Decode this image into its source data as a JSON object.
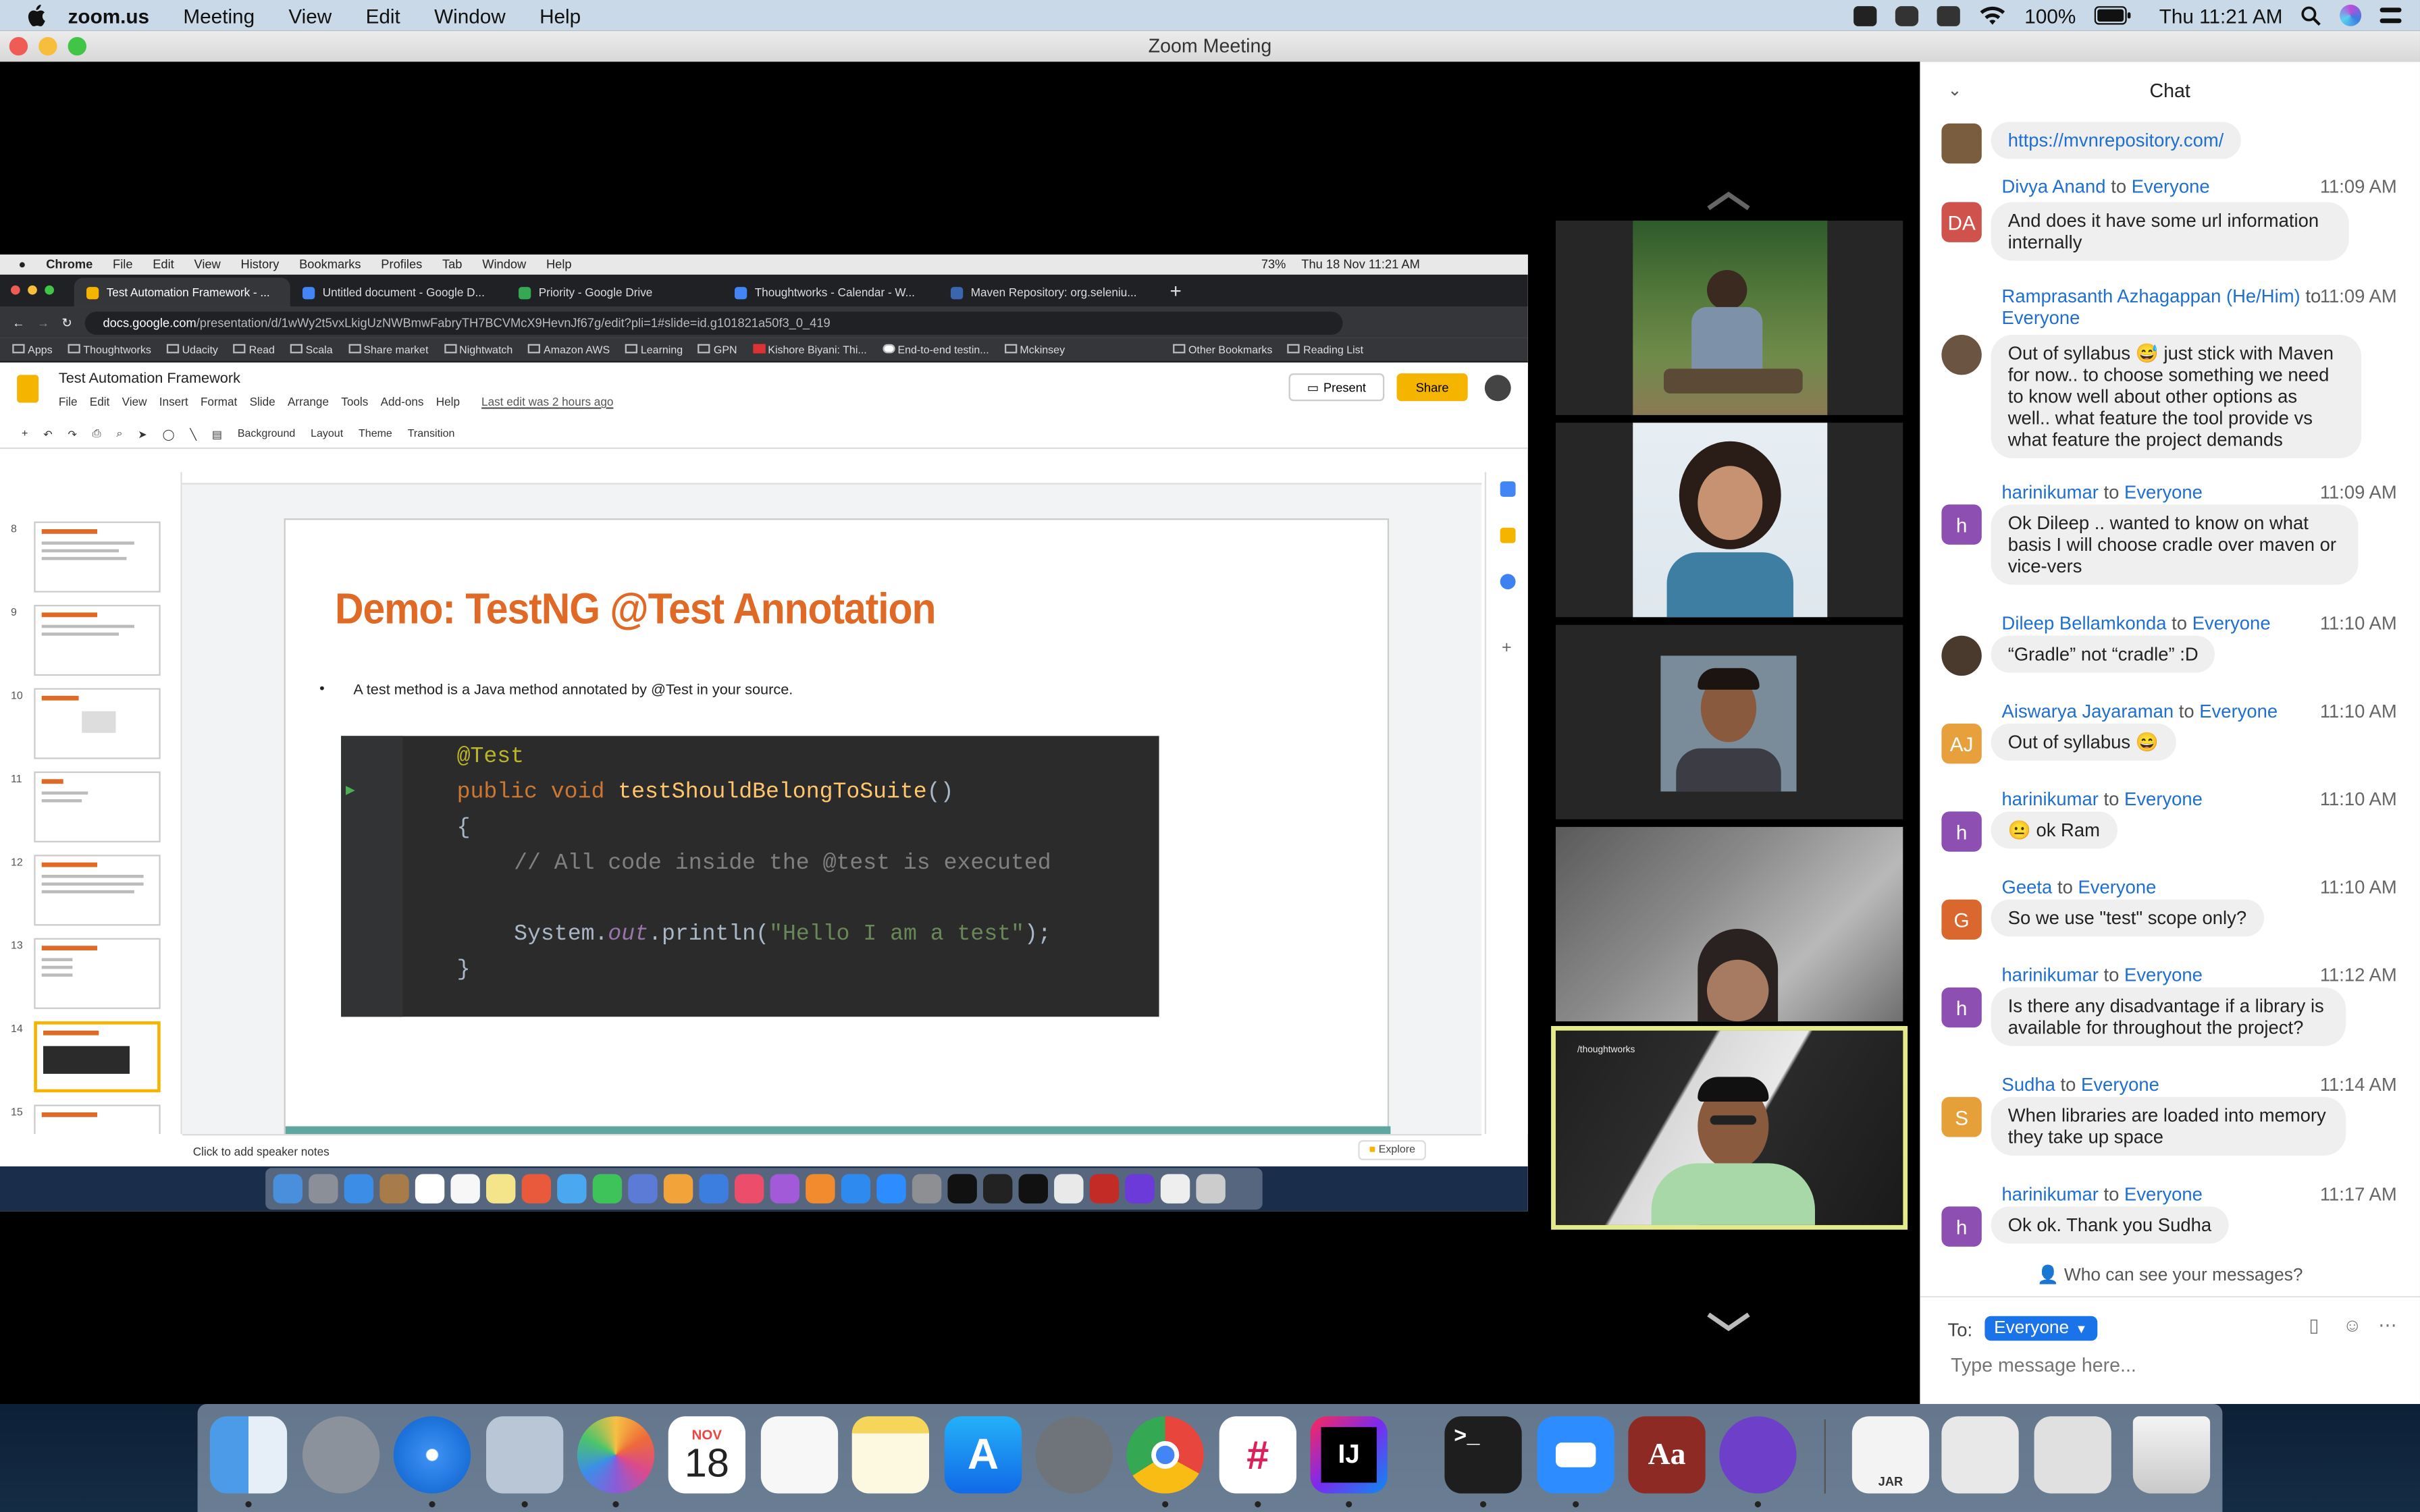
{
  "menubar": {
    "app": "zoom.us",
    "items": [
      "Meeting",
      "View",
      "Edit",
      "Window",
      "Help"
    ],
    "battery": "100%",
    "clock": "Thu 11:21 AM"
  },
  "window": {
    "title": "Zoom Meeting"
  },
  "shared": {
    "mac_menu": [
      "Chrome",
      "File",
      "Edit",
      "View",
      "History",
      "Bookmarks",
      "Profiles",
      "Tab",
      "Window",
      "Help"
    ],
    "mac_battery": "73%",
    "mac_clock": "Thu 18 Nov  11:21 AM",
    "tabs": [
      {
        "label": "Test Automation Framework - ...",
        "color": "#f4b400"
      },
      {
        "label": "Untitled document - Google D...",
        "color": "#4285f4"
      },
      {
        "label": "Priority - Google Drive",
        "color": "#34a853"
      },
      {
        "label": "Thoughtworks - Calendar - W...",
        "color": "#4285f4"
      },
      {
        "label": "Maven Repository: org.seleniu...",
        "color": "#3a66b0"
      }
    ],
    "url_host": "docs.google.com",
    "url_path": "/presentation/d/1wWy2t5vxLkigUzNWBmwFabryTH7BCVMcX9HevnJf67g/edit?pli=1#slide=id.g101821a50f3_0_419",
    "bookmarks": [
      "Apps",
      "Thoughtworks",
      "Udacity",
      "Read",
      "Scala",
      "Share market",
      "Nightwatch",
      "Amazon AWS",
      "Learning",
      "GPN",
      "Kishore Biyani: Thi...",
      "End-to-end testin...",
      "Mckinsey",
      "Other Bookmarks",
      "Reading List"
    ],
    "doc_title": "Test Automation Framework",
    "doc_menu": [
      "File",
      "Edit",
      "View",
      "Insert",
      "Format",
      "Slide",
      "Arrange",
      "Tools",
      "Add-ons",
      "Help"
    ],
    "last_edit": "Last edit was 2 hours ago",
    "present_label": "Present",
    "share_label": "Share",
    "toolbar": [
      "Background",
      "Layout",
      "Theme",
      "Transition"
    ],
    "slide_numbers": [
      "8",
      "9",
      "10",
      "11",
      "12",
      "13",
      "14",
      "15"
    ],
    "slide_title": "Demo: TestNG @Test Annotation",
    "slide_bullet": "A test method is a Java method annotated by @Test in your source.",
    "code": {
      "l1": "@Test",
      "l2a": "public void ",
      "l2b": "testShouldBelongToSuite",
      "l2c": "()",
      "l3": "{",
      "l4": "// All code inside the @test is executed",
      "l5a": "System.",
      "l5b": "out",
      "l5c": ".println(",
      "l5d": "\"Hello I am a test\"",
      "l5e": ");",
      "l6": "}"
    },
    "notes": "Click to add speaker notes",
    "explore": "Explore"
  },
  "chat": {
    "title": "Chat",
    "messages": [
      {
        "sender": "",
        "to": "",
        "time": "",
        "avatar": "photo",
        "initials": "",
        "color": "#7a5c3e",
        "text": "https://mvnrepository.com/",
        "link": true
      },
      {
        "sender": "Divya Anand",
        "to": "Everyone",
        "time": "11:09 AM",
        "initials": "DA",
        "color": "#d0524c",
        "text": "And does it have some url information internally"
      },
      {
        "sender": "Ramprasanth Azhagappan (He/Him)",
        "to": "Everyone",
        "time": "11:09 AM",
        "avatar": "photo",
        "initials": "",
        "color": "#6b5442",
        "text": "Out of syllabus 😅 just stick with Maven for now..  to choose something we need to know  well about other options as well.. what feature the tool provide vs what feature the project demands"
      },
      {
        "sender": "harinikumar",
        "to": "Everyone",
        "time": "11:09 AM",
        "initials": "h",
        "color": "#8e4fb3",
        "text": "Ok Dileep .. wanted to know on what basis I will choose cradle over maven or vice-vers"
      },
      {
        "sender": "Dileep Bellamkonda",
        "to": "Everyone",
        "time": "11:10 AM",
        "avatar": "photo",
        "initials": "",
        "color": "#4a3a2e",
        "text": "“Gradle” not “cradle” :D"
      },
      {
        "sender": "Aiswarya Jayaraman",
        "to": "Everyone",
        "time": "11:10 AM",
        "initials": "AJ",
        "color": "#e8a03c",
        "text": "Out of syllabus 😄"
      },
      {
        "sender": "harinikumar",
        "to": "Everyone",
        "time": "11:10 AM",
        "initials": "h",
        "color": "#8e4fb3",
        "text": "😐 ok Ram"
      },
      {
        "sender": "Geeta",
        "to": "Everyone",
        "time": "11:10 AM",
        "initials": "G",
        "color": "#d9672e",
        "text": "So we use \"test\" scope only?"
      },
      {
        "sender": "harinikumar",
        "to": "Everyone",
        "time": "11:12 AM",
        "initials": "h",
        "color": "#8e4fb3",
        "text": "Is there any disadvantage if a library is available for throughout the project?"
      },
      {
        "sender": "Sudha",
        "to": "Everyone",
        "time": "11:14 AM",
        "initials": "S",
        "color": "#e6a03a",
        "text": "When libraries are loaded into memory they take up space"
      },
      {
        "sender": "harinikumar",
        "to": "Everyone",
        "time": "11:17 AM",
        "initials": "h",
        "color": "#8e4fb3",
        "text": "Ok ok. Thank you Sudha"
      }
    ],
    "to_word": "to",
    "who_can_see": "Who can see your messages?",
    "to_label": "To:",
    "recipient": "Everyone",
    "input_placeholder": "Type message here..."
  },
  "video": {
    "tile5_label": "/thoughtworks"
  },
  "dock": {
    "calendar_month": "NOV",
    "calendar_day": "18",
    "intellij": "IJ",
    "terminal": ">_",
    "dictionary": "Aa",
    "jar": "JAR"
  }
}
